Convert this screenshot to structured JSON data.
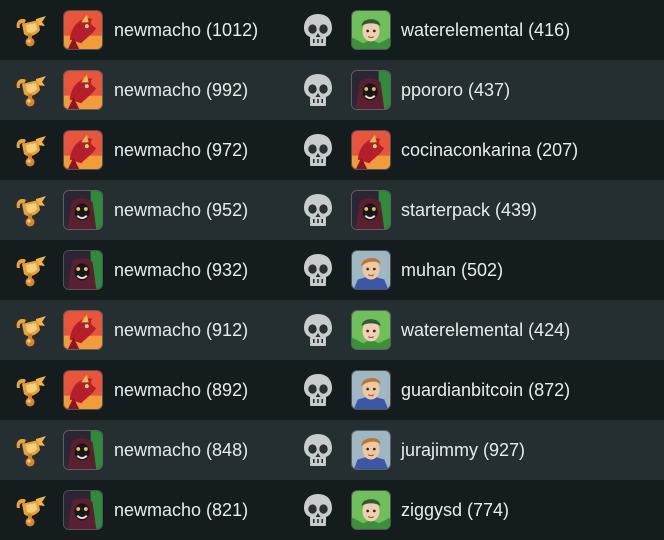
{
  "colors": {
    "row_dark": "#141c1e",
    "row_light": "#252e31",
    "text": "#e8eced",
    "trophy": "#e8a23a",
    "skull": "#c9cccd"
  },
  "matches": [
    {
      "winner": "newmacho (1012)",
      "winner_avatar": "red-dragon",
      "loser": "waterelemental (416)",
      "loser_avatar": "green-hero"
    },
    {
      "winner": "newmacho (992)",
      "winner_avatar": "red-dragon",
      "loser": "ppororo (437)",
      "loser_avatar": "dark-demon"
    },
    {
      "winner": "newmacho (972)",
      "winner_avatar": "red-dragon",
      "loser": "cocinaconkarina (207)",
      "loser_avatar": "red-dragon"
    },
    {
      "winner": "newmacho (952)",
      "winner_avatar": "dark-demon",
      "loser": "starterpack (439)",
      "loser_avatar": "dark-demon"
    },
    {
      "winner": "newmacho (932)",
      "winner_avatar": "dark-demon",
      "loser": "muhan (502)",
      "loser_avatar": "blue-knight"
    },
    {
      "winner": "newmacho (912)",
      "winner_avatar": "red-dragon",
      "loser": "waterelemental (424)",
      "loser_avatar": "green-hero"
    },
    {
      "winner": "newmacho (892)",
      "winner_avatar": "red-dragon",
      "loser": "guardianbitcoin (872)",
      "loser_avatar": "blue-knight"
    },
    {
      "winner": "newmacho (848)",
      "winner_avatar": "dark-demon",
      "loser": "jurajimmy (927)",
      "loser_avatar": "blue-knight"
    },
    {
      "winner": "newmacho (821)",
      "winner_avatar": "dark-demon",
      "loser": "ziggysd (774)",
      "loser_avatar": "green-hero"
    }
  ]
}
